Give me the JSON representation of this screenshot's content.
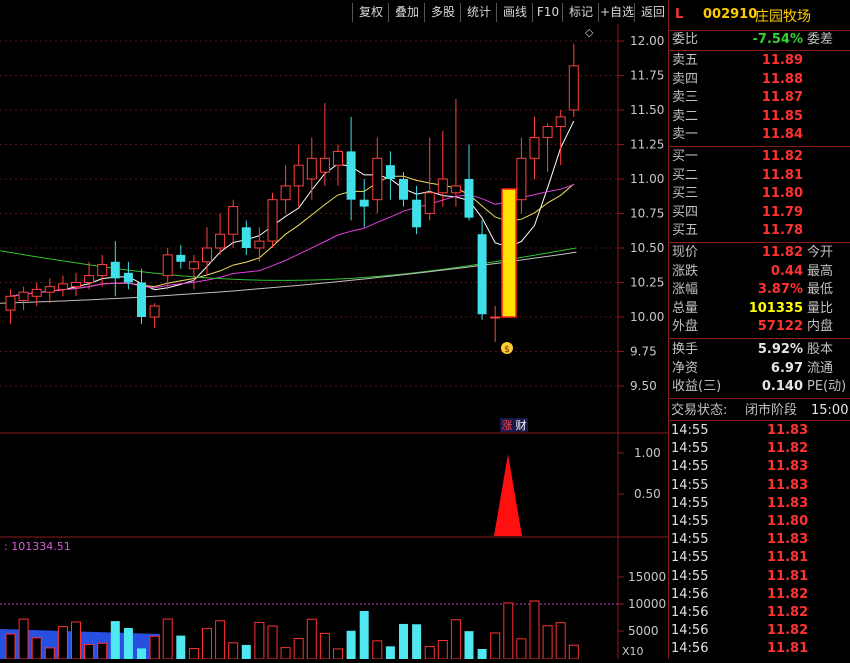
{
  "toolbar": {
    "buttons": [
      "复权",
      "叠加",
      "多股",
      "统计",
      "画线",
      "F10",
      "标记",
      "+自选",
      "返回"
    ],
    "diamond": "◇"
  },
  "stock": {
    "marker": "L",
    "code": "002910",
    "name": "庄园牧场"
  },
  "order_ratio": {
    "label": "委比",
    "value": "-7.54%",
    "label2": "委差"
  },
  "asks": [
    {
      "label": "卖五",
      "price": "11.89"
    },
    {
      "label": "卖四",
      "price": "11.88"
    },
    {
      "label": "卖三",
      "price": "11.87"
    },
    {
      "label": "卖二",
      "price": "11.85"
    },
    {
      "label": "卖一",
      "price": "11.84"
    }
  ],
  "bids": [
    {
      "label": "买一",
      "price": "11.82"
    },
    {
      "label": "买二",
      "price": "11.81"
    },
    {
      "label": "买三",
      "price": "11.80"
    },
    {
      "label": "买四",
      "price": "11.79"
    },
    {
      "label": "买五",
      "price": "11.78"
    }
  ],
  "stats": [
    {
      "label": "现价",
      "value": "11.82",
      "label2": "今开",
      "color": "red"
    },
    {
      "label": "涨跌",
      "value": "0.44",
      "label2": "最高",
      "color": "red"
    },
    {
      "label": "涨幅",
      "value": "3.87%",
      "label2": "最低",
      "color": "red"
    },
    {
      "label": "总量",
      "value": "101335",
      "label2": "量比",
      "color": "yellow"
    },
    {
      "label": "外盘",
      "value": "57122",
      "label2": "内盘",
      "color": "red"
    }
  ],
  "fundamentals": [
    {
      "label": "换手",
      "value": "5.92%",
      "label2": "股本"
    },
    {
      "label": "净资",
      "value": "6.97",
      "label2": "流通"
    },
    {
      "label": "收益(三)",
      "value": "0.140",
      "label2": "PE(动)"
    }
  ],
  "trade_status": {
    "label": "交易状态:",
    "value": "闭市阶段",
    "time": "15:00:"
  },
  "ticks": [
    {
      "time": "14:55",
      "price": "11.83"
    },
    {
      "time": "14:55",
      "price": "11.82"
    },
    {
      "time": "14:55",
      "price": "11.83"
    },
    {
      "time": "14:55",
      "price": "11.83"
    },
    {
      "time": "14:55",
      "price": "11.83"
    },
    {
      "time": "14:55",
      "price": "11.80"
    },
    {
      "time": "14:55",
      "price": "11.83"
    },
    {
      "time": "14:55",
      "price": "11.81"
    },
    {
      "time": "14:55",
      "price": "11.81"
    },
    {
      "time": "14:56",
      "price": "11.82"
    },
    {
      "time": "14:56",
      "price": "11.82"
    },
    {
      "time": "14:56",
      "price": "11.82"
    },
    {
      "time": "14:56",
      "price": "11.81"
    }
  ],
  "chart_data": {
    "type": "candlestick",
    "price_axis": {
      "ticks": [
        "12.00",
        "11.75",
        "11.50",
        "11.25",
        "11.00",
        "10.75",
        "10.50",
        "10.25",
        "10.00",
        "9.75",
        "9.50"
      ],
      "ylim": [
        9.4,
        12.1
      ]
    },
    "candles": [
      {
        "o": 10.05,
        "h": 10.2,
        "l": 9.95,
        "c": 10.15
      },
      {
        "o": 10.12,
        "h": 10.22,
        "l": 10.05,
        "c": 10.18
      },
      {
        "o": 10.15,
        "h": 10.25,
        "l": 10.08,
        "c": 10.2
      },
      {
        "o": 10.18,
        "h": 10.28,
        "l": 10.1,
        "c": 10.22
      },
      {
        "o": 10.2,
        "h": 10.3,
        "l": 10.15,
        "c": 10.24
      },
      {
        "o": 10.22,
        "h": 10.32,
        "l": 10.15,
        "c": 10.25
      },
      {
        "o": 10.25,
        "h": 10.4,
        "l": 10.2,
        "c": 10.3
      },
      {
        "o": 10.3,
        "h": 10.45,
        "l": 10.22,
        "c": 10.38
      },
      {
        "o": 10.4,
        "h": 10.55,
        "l": 10.15,
        "c": 10.28
      },
      {
        "o": 10.32,
        "h": 10.4,
        "l": 10.2,
        "c": 10.25
      },
      {
        "o": 10.25,
        "h": 10.35,
        "l": 9.95,
        "c": 10.0
      },
      {
        "o": 10.0,
        "h": 10.1,
        "l": 9.92,
        "c": 10.08
      },
      {
        "o": 10.3,
        "h": 10.5,
        "l": 10.2,
        "c": 10.45
      },
      {
        "o": 10.45,
        "h": 10.52,
        "l": 10.35,
        "c": 10.4
      },
      {
        "o": 10.35,
        "h": 10.45,
        "l": 10.2,
        "c": 10.4
      },
      {
        "o": 10.4,
        "h": 10.65,
        "l": 10.3,
        "c": 10.5
      },
      {
        "o": 10.5,
        "h": 10.75,
        "l": 10.45,
        "c": 10.6
      },
      {
        "o": 10.6,
        "h": 10.85,
        "l": 10.5,
        "c": 10.8
      },
      {
        "o": 10.65,
        "h": 10.7,
        "l": 10.45,
        "c": 10.5
      },
      {
        "o": 10.5,
        "h": 10.65,
        "l": 10.4,
        "c": 10.55
      },
      {
        "o": 10.55,
        "h": 10.9,
        "l": 10.5,
        "c": 10.85
      },
      {
        "o": 10.85,
        "h": 11.1,
        "l": 10.75,
        "c": 10.95
      },
      {
        "o": 10.95,
        "h": 11.25,
        "l": 10.8,
        "c": 11.1
      },
      {
        "o": 11.0,
        "h": 11.3,
        "l": 10.85,
        "c": 11.15
      },
      {
        "o": 11.05,
        "h": 11.55,
        "l": 10.95,
        "c": 11.15
      },
      {
        "o": 11.1,
        "h": 11.25,
        "l": 10.95,
        "c": 11.2
      },
      {
        "o": 11.2,
        "h": 11.45,
        "l": 10.7,
        "c": 10.85
      },
      {
        "o": 10.85,
        "h": 11.0,
        "l": 10.65,
        "c": 10.8
      },
      {
        "o": 10.85,
        "h": 11.3,
        "l": 10.75,
        "c": 11.15
      },
      {
        "o": 11.1,
        "h": 11.2,
        "l": 10.85,
        "c": 11.0
      },
      {
        "o": 11.0,
        "h": 11.05,
        "l": 10.8,
        "c": 10.85
      },
      {
        "o": 10.85,
        "h": 10.95,
        "l": 10.6,
        "c": 10.65
      },
      {
        "o": 10.75,
        "h": 11.3,
        "l": 10.7,
        "c": 10.9
      },
      {
        "o": 10.9,
        "h": 11.35,
        "l": 10.8,
        "c": 11.0
      },
      {
        "o": 10.9,
        "h": 11.58,
        "l": 10.8,
        "c": 10.95
      },
      {
        "o": 11.0,
        "h": 11.25,
        "l": 10.7,
        "c": 10.72
      },
      {
        "o": 10.6,
        "h": 10.7,
        "l": 9.98,
        "c": 10.02
      },
      {
        "o": 10.0,
        "h": 10.08,
        "l": 9.82,
        "c": 10.0
      },
      {
        "o": 10.6,
        "h": 10.9,
        "l": 10.5,
        "c": 10.85
      },
      {
        "o": 10.85,
        "h": 11.3,
        "l": 10.75,
        "c": 11.15
      },
      {
        "o": 11.15,
        "h": 11.45,
        "l": 11.0,
        "c": 11.3
      },
      {
        "o": 11.3,
        "h": 11.4,
        "l": 11.05,
        "c": 11.38
      },
      {
        "o": 11.38,
        "h": 11.5,
        "l": 11.1,
        "c": 11.45
      },
      {
        "o": 11.5,
        "h": 11.98,
        "l": 11.45,
        "c": 11.82
      }
    ],
    "signal_labels": [
      "涨",
      "财"
    ],
    "signal_axis": {
      "ticks": [
        "1.00",
        "0.50"
      ]
    },
    "volume_axis": {
      "label": ": 101334.51",
      "ticks": [
        "15000",
        "10000",
        "5000"
      ],
      "unit": "X10"
    }
  }
}
